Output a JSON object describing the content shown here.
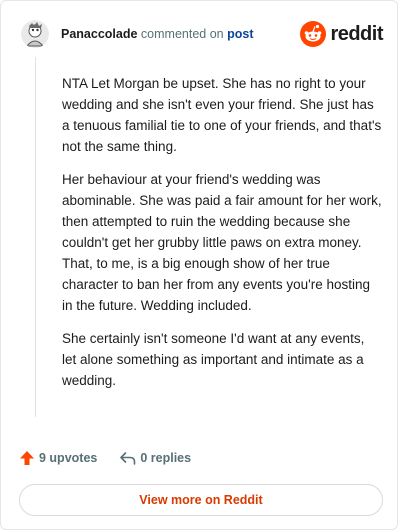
{
  "header": {
    "username": "Panaccolade",
    "action_text": "commented on",
    "target_link": "post",
    "brand": "reddit"
  },
  "comment": {
    "paragraphs": [
      "NTA Let Morgan be upset. She has no right to your wedding and she isn't even your friend. She just has a tenuous familial tie to one of your friends, and that's not the same thing.",
      "Her behaviour at your friend's wedding was abominable. She was paid a fair amount for her work, then attempted to ruin the wedding because she couldn't get her grubby little paws on extra money. That, to me, is a big enough show of her true character to ban her from any events you're hosting in the future. Wedding included.",
      "She certainly isn't someone I'd want at any events, let alone something as important and intimate as a wedding."
    ]
  },
  "actions": {
    "upvotes": "9 upvotes",
    "replies": "0 replies"
  },
  "footer": {
    "view_more": "View more on Reddit"
  },
  "colors": {
    "brand": "#ff4500",
    "link": "#0a449b",
    "muted": "#576f76",
    "button_text": "#d93a00"
  },
  "icons": {
    "avatar": "user-avatar",
    "logo": "reddit-snoo-icon",
    "upvote": "upvote-arrow-icon",
    "reply": "reply-arrow-icon"
  }
}
